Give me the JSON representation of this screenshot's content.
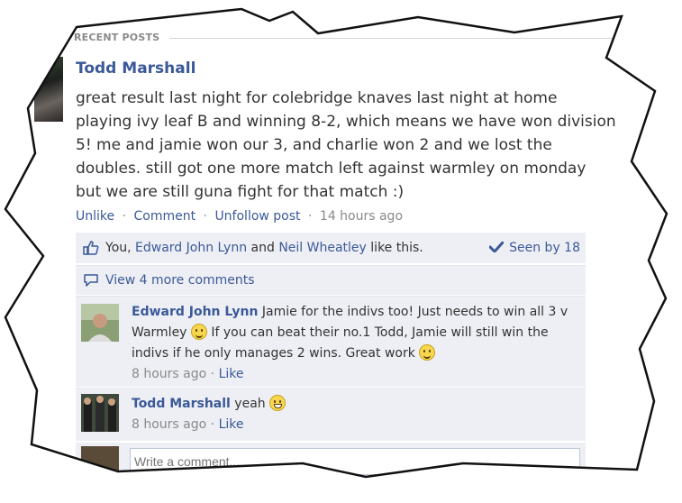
{
  "section_header": "RECENT POSTS",
  "post": {
    "author": "Todd Marshall",
    "text": "great result last night for colebridge knaves last night at home playing ivy leaf B and winning 8-2, which means we have won division 5! me and jamie won our 3, and charlie won 2 and we lost the doubles. still got one more match left against warmley on monday but we are still guna fight for that match :)",
    "actions": {
      "unlike": "Unlike",
      "comment": "Comment",
      "unfollow": "Unfollow post",
      "time": "14 hours ago",
      "separator": "·"
    }
  },
  "likes": {
    "prefix": "You, ",
    "person1": "Edward John Lynn",
    "middle": " and ",
    "person2": "Neil Wheatley",
    "suffix": " like this.",
    "seen": "Seen by 18"
  },
  "more_comments": "View 4 more comments",
  "comments": [
    {
      "author": "Edward John Lynn",
      "text_part1": " Jamie for the indivs too! Just needs to win all 3 v Warmley ",
      "text_part2": " If you can beat their no.1 Todd, Jamie will still win the indivs if he only manages 2 wins. Great work ",
      "time": "8 hours ago",
      "like": "Like"
    },
    {
      "author": "Todd Marshall",
      "text": " yeah ",
      "time": "8 hours ago",
      "like": "Like"
    }
  ],
  "write_placeholder": "Write a comment...",
  "colors": {
    "link": "#3b5998",
    "panel": "#edeff4",
    "meta": "#8a8a8a"
  }
}
